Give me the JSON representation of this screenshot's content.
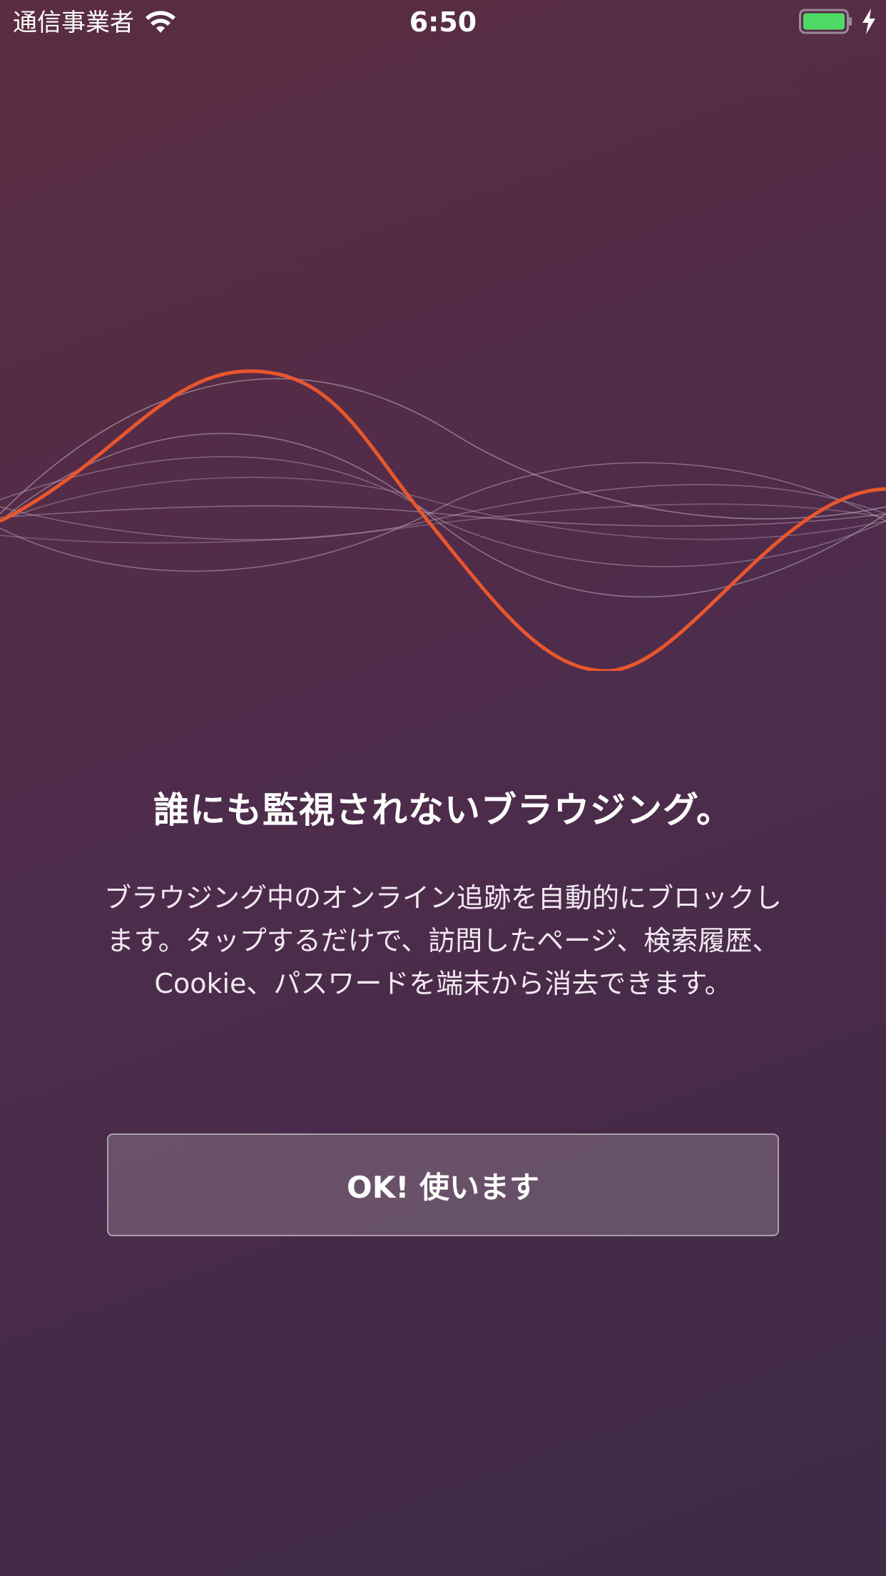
{
  "status_bar": {
    "carrier": "通信事業者",
    "time": "6:50",
    "wifi_icon": "wifi-icon",
    "battery_icon": "battery-icon",
    "charging_icon": "charging-bolt-icon",
    "battery_color": "#4cd964"
  },
  "illustration": {
    "accent_color": "#e8562e",
    "line_color": "#c9b8c6"
  },
  "onboarding": {
    "headline": "誰にも監視されないブラウジング。",
    "description": "ブラウジング中のオンライン追跡を自動的にブロックします。タップするだけで、訪問したページ、検索履歴、Cookie、パスワードを端末から消去できます。",
    "ok_button_label": "OK! 使います"
  }
}
